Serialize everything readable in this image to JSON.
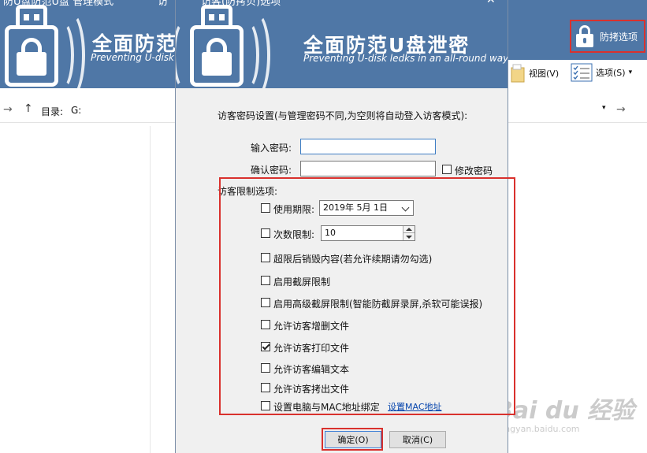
{
  "background_window": {
    "title_fragment_left": "防U盘防范U盘  管理模式",
    "title_fragment_mid": "访",
    "brand_title": "全面防范",
    "brand_subtitle": "Preventing U-disk",
    "protect_options_label": "防拷选项",
    "toolbar": {
      "view_label": "视图(V)",
      "options_label": "选项(S)"
    },
    "address": {
      "directory_label": "目录:",
      "directory_value": "G:"
    }
  },
  "dialog": {
    "title": "访客(防拷贝)选项",
    "brand_title": "全面防范U盘泄密",
    "brand_subtitle": "Preventing U-disk ledks in an all-round way",
    "password_section_label": "访客密码设置(与管理密码不同,为空则将自动登入访客模式):",
    "enter_password_label": "输入密码:",
    "enter_password_value": "",
    "confirm_password_label": "确认密码:",
    "confirm_password_value": "",
    "modify_password_label": "修改密码",
    "modify_password_checked": false,
    "restrictions_label": "访客限制选项:",
    "options": [
      {
        "label": "使用期限:",
        "checked": false
      },
      {
        "label": "次数限制:",
        "checked": false
      },
      {
        "label": "超限后销毁内容(若允许续期请勿勾选)",
        "checked": false
      },
      {
        "label": "启用截屏限制",
        "checked": false
      },
      {
        "label": "启用高级截屏限制(智能防截屏录屏,杀软可能误报)",
        "checked": false
      },
      {
        "label": "允许访客增删文件",
        "checked": false
      },
      {
        "label": "允许访客打印文件",
        "checked": true
      },
      {
        "label": "允许访客编辑文本",
        "checked": false
      },
      {
        "label": "允许访客拷出文件",
        "checked": false
      },
      {
        "label": "设置电脑与MAC地址绑定",
        "checked": false
      }
    ],
    "expiry_date_value": "2019年  5月  1日",
    "count_limit_value": "10",
    "set_mac_link": "设置MAC地址",
    "ok_button": "确定(O)",
    "cancel_button": "取消(C)"
  },
  "watermark": {
    "brand": "Bai du 经验",
    "url": "jingyan.baidu.com"
  },
  "colors": {
    "banner_blue": "#4f77a6",
    "highlight_red": "#d9312d",
    "link_blue": "#0645ad",
    "dialog_bg": "#f0f0f0"
  }
}
